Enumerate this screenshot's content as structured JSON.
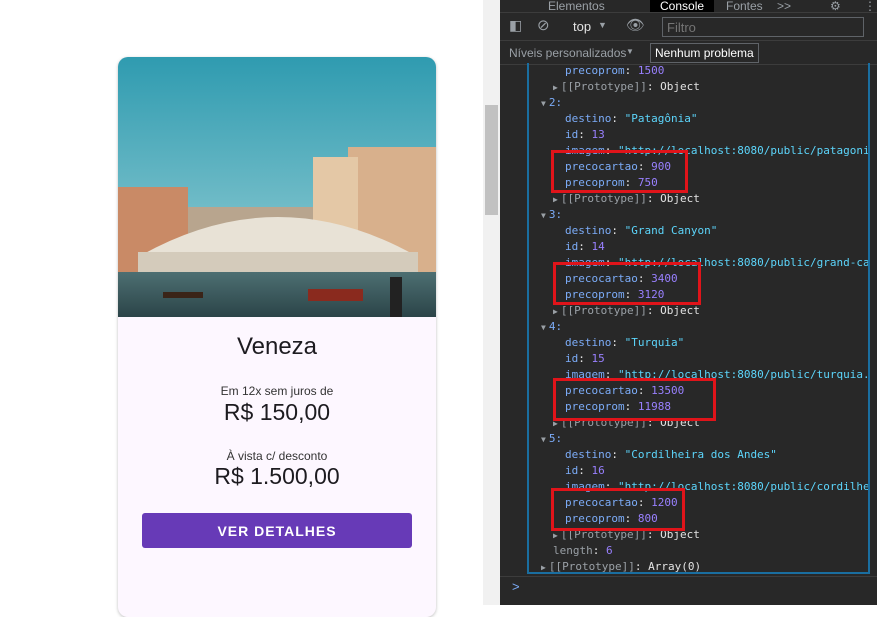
{
  "card": {
    "title": "Veneza",
    "installment_label": "Em 12x sem juros de",
    "installment_price": "R$ 150,00",
    "cash_label": "À vista c/ desconto",
    "cash_price": "R$ 1.500,00",
    "button_label": "VER DETALHES",
    "accent_color": "#673ab7"
  },
  "devtools": {
    "tabs": [
      "Elementos",
      "Console",
      "Fontes",
      ">>"
    ],
    "active_tab": "Console",
    "context": "top",
    "filter_placeholder": "Filtro",
    "levels": "Níveis personalizados",
    "issues": "Nenhum problema",
    "log_lines": [
      {
        "indent": 2,
        "key": "precoprom",
        "val": "1500",
        "type": "n"
      },
      {
        "indent": 1,
        "proto": true,
        "text": "[[Prototype]]",
        "val": "Object"
      },
      {
        "indent": 0,
        "idx": "2:"
      },
      {
        "indent": 2,
        "key": "destino",
        "val": "\"Patagônia\"",
        "type": "s"
      },
      {
        "indent": 2,
        "key": "id",
        "val": "13",
        "type": "n"
      },
      {
        "indent": 2,
        "key": "imagem",
        "val": "\"http://localhost:8080/public/patagonia",
        "type": "s"
      },
      {
        "indent": 2,
        "key": "precocartao",
        "val": "900",
        "type": "n"
      },
      {
        "indent": 2,
        "key": "precoprom",
        "val": "750",
        "type": "n"
      },
      {
        "indent": 1,
        "proto": true,
        "text": "[[Prototype]]",
        "val": "Object"
      },
      {
        "indent": 0,
        "idx": "3:"
      },
      {
        "indent": 2,
        "key": "destino",
        "val": "\"Grand Canyon\"",
        "type": "s"
      },
      {
        "indent": 2,
        "key": "id",
        "val": "14",
        "type": "n"
      },
      {
        "indent": 2,
        "key": "imagem",
        "val": "\"http://localhost:8080/public/grand-can",
        "type": "s"
      },
      {
        "indent": 2,
        "key": "precocartao",
        "val": "3400",
        "type": "n"
      },
      {
        "indent": 2,
        "key": "precoprom",
        "val": "3120",
        "type": "n"
      },
      {
        "indent": 1,
        "proto": true,
        "text": "[[Prototype]]",
        "val": "Object"
      },
      {
        "indent": 0,
        "idx": "4:"
      },
      {
        "indent": 2,
        "key": "destino",
        "val": "\"Turquia\"",
        "type": "s"
      },
      {
        "indent": 2,
        "key": "id",
        "val": "15",
        "type": "n"
      },
      {
        "indent": 2,
        "key": "imagem",
        "val": "\"http://localhost:8080/public/turquia.p",
        "type": "s"
      },
      {
        "indent": 2,
        "key": "precocartao",
        "val": "13500",
        "type": "n"
      },
      {
        "indent": 2,
        "key": "precoprom",
        "val": "11988",
        "type": "n"
      },
      {
        "indent": 1,
        "proto": true,
        "text": "[[Prototype]]",
        "val": "Object"
      },
      {
        "indent": 0,
        "idx": "5:"
      },
      {
        "indent": 2,
        "key": "destino",
        "val": "\"Cordilheira dos Andes\"",
        "type": "s"
      },
      {
        "indent": 2,
        "key": "id",
        "val": "16",
        "type": "n"
      },
      {
        "indent": 2,
        "key": "imagem",
        "val": "\"http://localhost:8080/public/cordilhei",
        "type": "s"
      },
      {
        "indent": 2,
        "key": "precocartao",
        "val": "1200",
        "type": "n"
      },
      {
        "indent": 2,
        "key": "precoprom",
        "val": "800",
        "type": "n"
      },
      {
        "indent": 1,
        "proto": true,
        "text": "[[Prototype]]",
        "val": "Object"
      },
      {
        "indent": 1,
        "key": "length",
        "val": "6",
        "type": "n",
        "dim": true
      },
      {
        "indent": 0,
        "proto": true,
        "text": "[[Prototype]]",
        "val": "Array(0)"
      }
    ],
    "prompt": ">",
    "highlight_color": "#e0141a"
  }
}
